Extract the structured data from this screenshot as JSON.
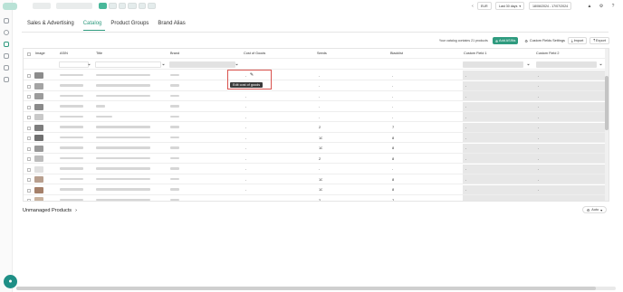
{
  "topbar": {
    "currency": "EUR",
    "range_label": "Last 30 days",
    "date_range": "18/06/2024 - 17/07/2024"
  },
  "tabs": [
    "Sales & Advertising",
    "Catalog",
    "Product Groups",
    "Brand Alias"
  ],
  "active_tab": 1,
  "toolbar": {
    "catalog_info": "Your catalog contains 21 products",
    "add_asins": "Add ASINs",
    "custom_fields": "Custom Fields Settings",
    "import": "Import",
    "export": "Export"
  },
  "table": {
    "columns": [
      "Image",
      "ASIN",
      "Title",
      "Brand",
      "Cost of Goods",
      "Seeds",
      "Blacklist",
      "Custom Field 1",
      "Custom Field 2"
    ],
    "rows": [
      {
        "cog": "-",
        "seeds": "-",
        "blacklist": "-",
        "cf1": "-",
        "cf2": "-"
      },
      {
        "cog": "-",
        "seeds": "-",
        "blacklist": "-",
        "cf1": "-",
        "cf2": "-"
      },
      {
        "cog": "-",
        "seeds": "-",
        "blacklist": "-",
        "cf1": "-",
        "cf2": "-"
      },
      {
        "cog": "-",
        "seeds": "-",
        "blacklist": "-",
        "cf1": "-",
        "cf2": "-"
      },
      {
        "cog": "-",
        "seeds": "-",
        "blacklist": "-",
        "cf1": "-",
        "cf2": "-"
      },
      {
        "cog": "-",
        "seeds": "2",
        "blacklist": "7",
        "cf1": "-",
        "cf2": "-"
      },
      {
        "cog": "-",
        "seeds": "10",
        "blacklist": "8",
        "cf1": "-",
        "cf2": "-"
      },
      {
        "cog": "-",
        "seeds": "10",
        "blacklist": "8",
        "cf1": "-",
        "cf2": "-"
      },
      {
        "cog": "-",
        "seeds": "2",
        "blacklist": "8",
        "cf1": "-",
        "cf2": "-"
      },
      {
        "cog": "-",
        "seeds": "-",
        "blacklist": "-",
        "cf1": "-",
        "cf2": "-"
      },
      {
        "cog": "-",
        "seeds": "10",
        "blacklist": "8",
        "cf1": "-",
        "cf2": "-"
      },
      {
        "cog": "-",
        "seeds": "10",
        "blacklist": "8",
        "cf1": "-",
        "cf2": "-"
      },
      {
        "cog": "-",
        "seeds": "2",
        "blacklist": "7",
        "cf1": "-",
        "cf2": "-"
      }
    ]
  },
  "tooltip": "Edit cost of goods",
  "unmanaged_products": "Unmanaged Products",
  "auto_button": "Auto",
  "colors": {
    "accent": "#2f9b7f",
    "highlight": "#d9534f"
  }
}
